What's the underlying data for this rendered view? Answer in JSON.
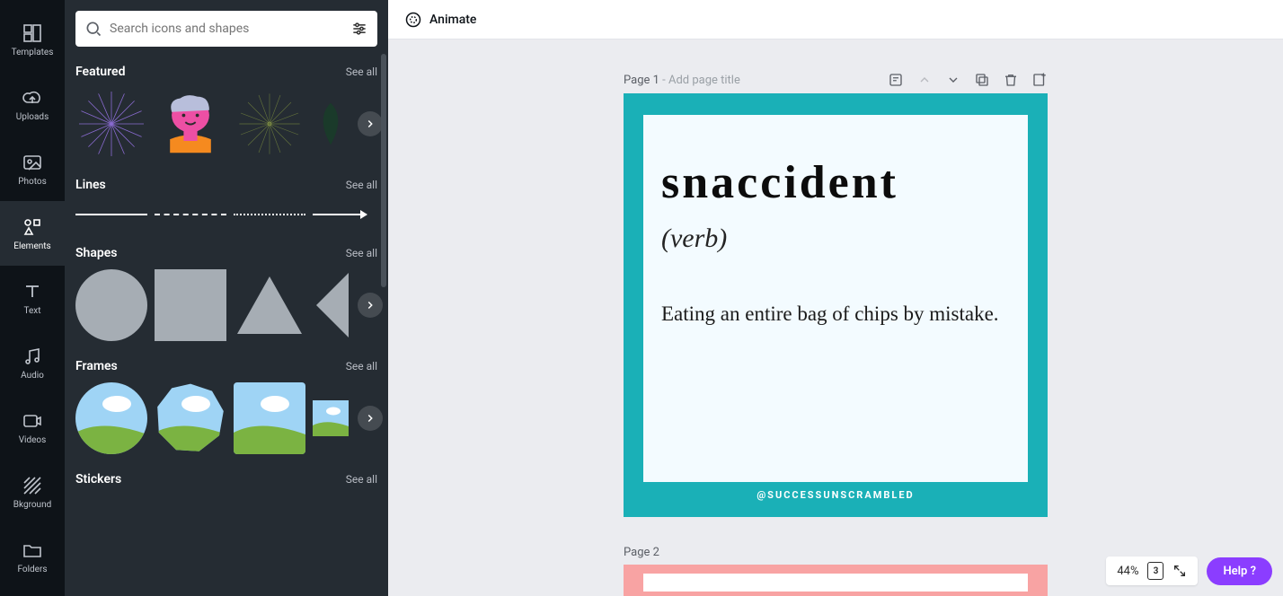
{
  "rail": {
    "templates": "Templates",
    "uploads": "Uploads",
    "photos": "Photos",
    "elements": "Elements",
    "text": "Text",
    "audio": "Audio",
    "videos": "Videos",
    "bkground": "Bkground",
    "folders": "Folders"
  },
  "search": {
    "placeholder": "Search icons and shapes"
  },
  "sections": {
    "featured": {
      "title": "Featured",
      "see_all": "See all"
    },
    "lines": {
      "title": "Lines",
      "see_all": "See all"
    },
    "shapes": {
      "title": "Shapes",
      "see_all": "See all"
    },
    "frames": {
      "title": "Frames",
      "see_all": "See all"
    },
    "stickers": {
      "title": "Stickers",
      "see_all": "See all"
    }
  },
  "topbar": {
    "animate": "Animate"
  },
  "pages": {
    "p1": {
      "label_prefix": "Page 1",
      "label_sep": " - ",
      "label_suffix": "Add page title",
      "word": "snaccident",
      "pos": "(verb)",
      "definition": "Eating an entire bag of chips by mistake.",
      "handle": "@SUCCESSUNSCRAMBLED"
    },
    "p2": {
      "label": "Page 2"
    }
  },
  "zoom": {
    "percent": "44%",
    "page_count": "3",
    "help": "Help ?"
  },
  "colors": {
    "accent_teal": "#1ab0b7",
    "accent_pink": "#f8a3a3",
    "purple_brand": "#8b3dff"
  }
}
